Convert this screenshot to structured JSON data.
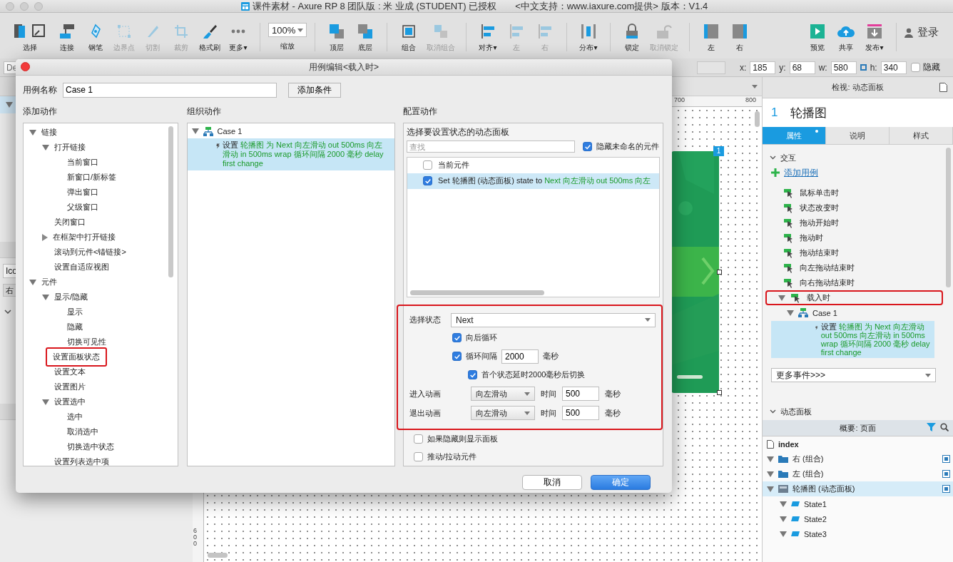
{
  "window": {
    "title": "课件素材 - Axure RP 8 团队版 : 米 业成 (STUDENT) 已授权",
    "subtitle": "<中文支持：www.iaxure.com提供> 版本：V1.4"
  },
  "toolbar": {
    "groups": [
      [
        {
          "kind": "select",
          "label": "选择",
          "disabled": false
        },
        {
          "kind": "connect",
          "label": "连接",
          "disabled": false
        },
        {
          "kind": "pen",
          "label": "钢笔",
          "disabled": false
        },
        {
          "kind": "points",
          "label": "边界点",
          "disabled": true
        },
        {
          "kind": "cut",
          "label": "切割",
          "disabled": true
        },
        {
          "kind": "crop",
          "label": "裁剪",
          "disabled": true
        },
        {
          "kind": "brush",
          "label": "格式刷",
          "disabled": false
        },
        {
          "kind": "more",
          "label": "更多▾",
          "disabled": false
        }
      ],
      [
        {
          "kind": "zoom",
          "value": "100%",
          "label": "缩放"
        }
      ],
      [
        {
          "kind": "front",
          "label": "顶层",
          "disabled": false
        },
        {
          "kind": "back",
          "label": "底层",
          "disabled": false
        }
      ],
      [
        {
          "kind": "group",
          "label": "组合",
          "disabled": false
        },
        {
          "kind": "ungroup",
          "label": "取消组合",
          "disabled": true
        }
      ],
      [
        {
          "kind": "align",
          "label": "对齐▾",
          "disabled": false
        },
        {
          "kind": "align-left",
          "label": "左",
          "disabled": true
        },
        {
          "kind": "align-right",
          "label": "右",
          "disabled": true
        }
      ],
      [
        {
          "kind": "distribute",
          "label": "分布▾",
          "disabled": false
        }
      ],
      [
        {
          "kind": "lock",
          "label": "锁定",
          "disabled": false
        },
        {
          "kind": "unlock",
          "label": "取消锁定",
          "disabled": true
        }
      ],
      [
        {
          "kind": "panel-left",
          "label": "左",
          "disabled": false
        },
        {
          "kind": "panel-right",
          "label": "右",
          "disabled": false
        }
      ]
    ],
    "right_groups": [
      [
        {
          "kind": "preview",
          "label": "预览",
          "disabled": false
        },
        {
          "kind": "share",
          "label": "共享",
          "disabled": false
        },
        {
          "kind": "publish",
          "label": "发布▾",
          "disabled": false
        }
      ],
      [
        {
          "kind": "login",
          "label": "登录",
          "disabled": false
        }
      ]
    ]
  },
  "properties_bar": {
    "name_field": "De",
    "fields": [
      {
        "label": "x:",
        "value": "185"
      },
      {
        "label": "y:",
        "value": "68"
      },
      {
        "label": "w:",
        "value": "580"
      },
      {
        "label": "h:",
        "value": "340"
      }
    ],
    "hidden": {
      "label": "隐藏",
      "checked": false
    }
  },
  "left_panel": {
    "field": "Ico",
    "tab": "右"
  },
  "canvas": {
    "ruler_marks": [
      "700",
      "800"
    ],
    "vertical_ruler_mark": "600",
    "badge": "1"
  },
  "inspector": {
    "title": "检视: 动态面板",
    "number": "1",
    "name": "轮播图",
    "tabs": [
      {
        "label": "属性",
        "selected": true
      },
      {
        "label": "说明",
        "selected": false
      },
      {
        "label": "样式",
        "selected": false
      }
    ],
    "section": "交互",
    "add_case": "添加用例",
    "events": [
      {
        "label": "鼠标单击时",
        "highlighted": false
      },
      {
        "label": "状态改变时",
        "highlighted": false
      },
      {
        "label": "拖动开始时",
        "highlighted": false
      },
      {
        "label": "拖动时",
        "highlighted": false
      },
      {
        "label": "拖动结束时",
        "highlighted": false
      },
      {
        "label": "向左拖动结束时",
        "highlighted": false
      },
      {
        "label": "向右拖动结束时",
        "highlighted": false
      },
      {
        "label": "载入时",
        "highlighted": true,
        "expanded": true,
        "cases": [
          {
            "label": "Case 1",
            "expanded": true,
            "actions": [
              {
                "verb": "设置",
                "detail": "轮播图 为 Next 向左滑动 out 500ms 向左滑动 in 500ms wrap 循环间隔 2000 毫秒 delay first change"
              }
            ]
          }
        ]
      }
    ],
    "more_events": "更多事件>>>",
    "panel_section": "动态面板"
  },
  "outline": {
    "title": "概要: 页面",
    "page": "index",
    "items": [
      {
        "label": "右 (组合)",
        "kind": "folder",
        "expanded": true,
        "selected": false
      },
      {
        "label": "左 (组合)",
        "kind": "folder",
        "expanded": true,
        "selected": false
      },
      {
        "label": "轮播图 (动态面板)",
        "kind": "panel",
        "expanded": true,
        "selected": true,
        "children": [
          {
            "label": "State1",
            "kind": "state",
            "expanded": true,
            "selected": false
          },
          {
            "label": "State2",
            "kind": "state",
            "expanded": true,
            "selected": false
          },
          {
            "label": "State3",
            "kind": "state",
            "expanded": true,
            "selected": false
          }
        ]
      }
    ]
  },
  "dialog": {
    "title": "用例编辑<载入时>",
    "case_name_label": "用例名称",
    "case_name": "Case 1",
    "add_condition": "添加条件",
    "add_actions": {
      "title": "添加动作",
      "tree": [
        {
          "label": "链接",
          "expanded": true,
          "highlighted": false,
          "children": [
            {
              "label": "打开链接",
              "expanded": true,
              "highlighted": false,
              "children": [
                {
                  "label": "当前窗口",
                  "highlighted": false
                },
                {
                  "label": "新窗口/新标签",
                  "highlighted": false
                },
                {
                  "label": "弹出窗口",
                  "highlighted": false
                },
                {
                  "label": "父级窗口",
                  "highlighted": false
                }
              ]
            },
            {
              "label": "关闭窗口",
              "highlighted": false
            },
            {
              "label": "在框架中打开链接",
              "expanded": false,
              "highlighted": false
            },
            {
              "label": "滚动到元件<锚链接>",
              "highlighted": false
            },
            {
              "label": "设置自适应视图",
              "highlighted": false
            }
          ]
        },
        {
          "label": "元件",
          "expanded": true,
          "highlighted": false,
          "children": [
            {
              "label": "显示/隐藏",
              "expanded": true,
              "highlighted": false,
              "children": [
                {
                  "label": "显示",
                  "highlighted": false
                },
                {
                  "label": "隐藏",
                  "highlighted": false
                },
                {
                  "label": "切换可见性",
                  "highlighted": false
                }
              ]
            },
            {
              "label": "设置面板状态",
              "highlighted": true
            },
            {
              "label": "设置文本",
              "highlighted": false
            },
            {
              "label": "设置图片",
              "highlighted": false
            },
            {
              "label": "设置选中",
              "expanded": true,
              "highlighted": false,
              "children": [
                {
                  "label": "选中",
                  "highlighted": false
                },
                {
                  "label": "取消选中",
                  "highlighted": false
                },
                {
                  "label": "切换选中状态",
                  "highlighted": false
                }
              ]
            },
            {
              "label": "设置列表选中项",
              "highlighted": false
            }
          ]
        }
      ]
    },
    "organize": {
      "title": "组织动作",
      "cases": [
        {
          "label": "Case 1",
          "expanded": true,
          "actions": [
            {
              "verb": "设置",
              "detail": "轮播图 为 Next 向左滑动 out 500ms 向左滑动 in 500ms wrap 循环间隔 2000 毫秒 delay first change",
              "selected": true
            }
          ]
        }
      ]
    },
    "configure": {
      "title": "配置动作",
      "heading": "选择要设置状态的动态面板",
      "search_placeholder": "查找",
      "hide_unnamed": {
        "label": "隐藏未命名的元件",
        "checked": true
      },
      "targets": [
        {
          "text": "当前元件",
          "checked": false,
          "selected": false
        },
        {
          "text": "Set 轮播图 (动态面板) state to ",
          "detail": "Next 向左滑动 out 500ms 向左",
          "checked": true,
          "selected": true
        }
      ],
      "settings": {
        "highlighted": true,
        "state_label": "选择状态",
        "state": "Next",
        "options": [
          {
            "kind": "check",
            "label": "向后循环",
            "checked": true
          },
          {
            "kind": "interval",
            "label": "循环间隔",
            "checked": true,
            "value": "2000",
            "unit": "毫秒"
          },
          {
            "kind": "sub",
            "label": "首个状态延时2000毫秒后切换",
            "checked": true
          }
        ],
        "animations": [
          {
            "label": "进入动画",
            "effect": "向左滑动",
            "time_label": "时间",
            "time": "500",
            "unit": "毫秒"
          },
          {
            "label": "退出动画",
            "effect": "向左滑动",
            "time_label": "时间",
            "time": "500",
            "unit": "毫秒"
          }
        ]
      },
      "extra_options": [
        {
          "label": "如果隐藏则显示面板",
          "checked": false
        },
        {
          "label": "推动/拉动元件",
          "checked": false
        }
      ]
    },
    "buttons": [
      {
        "label": "取消",
        "primary": false
      },
      {
        "label": "确定",
        "primary": true
      }
    ]
  }
}
